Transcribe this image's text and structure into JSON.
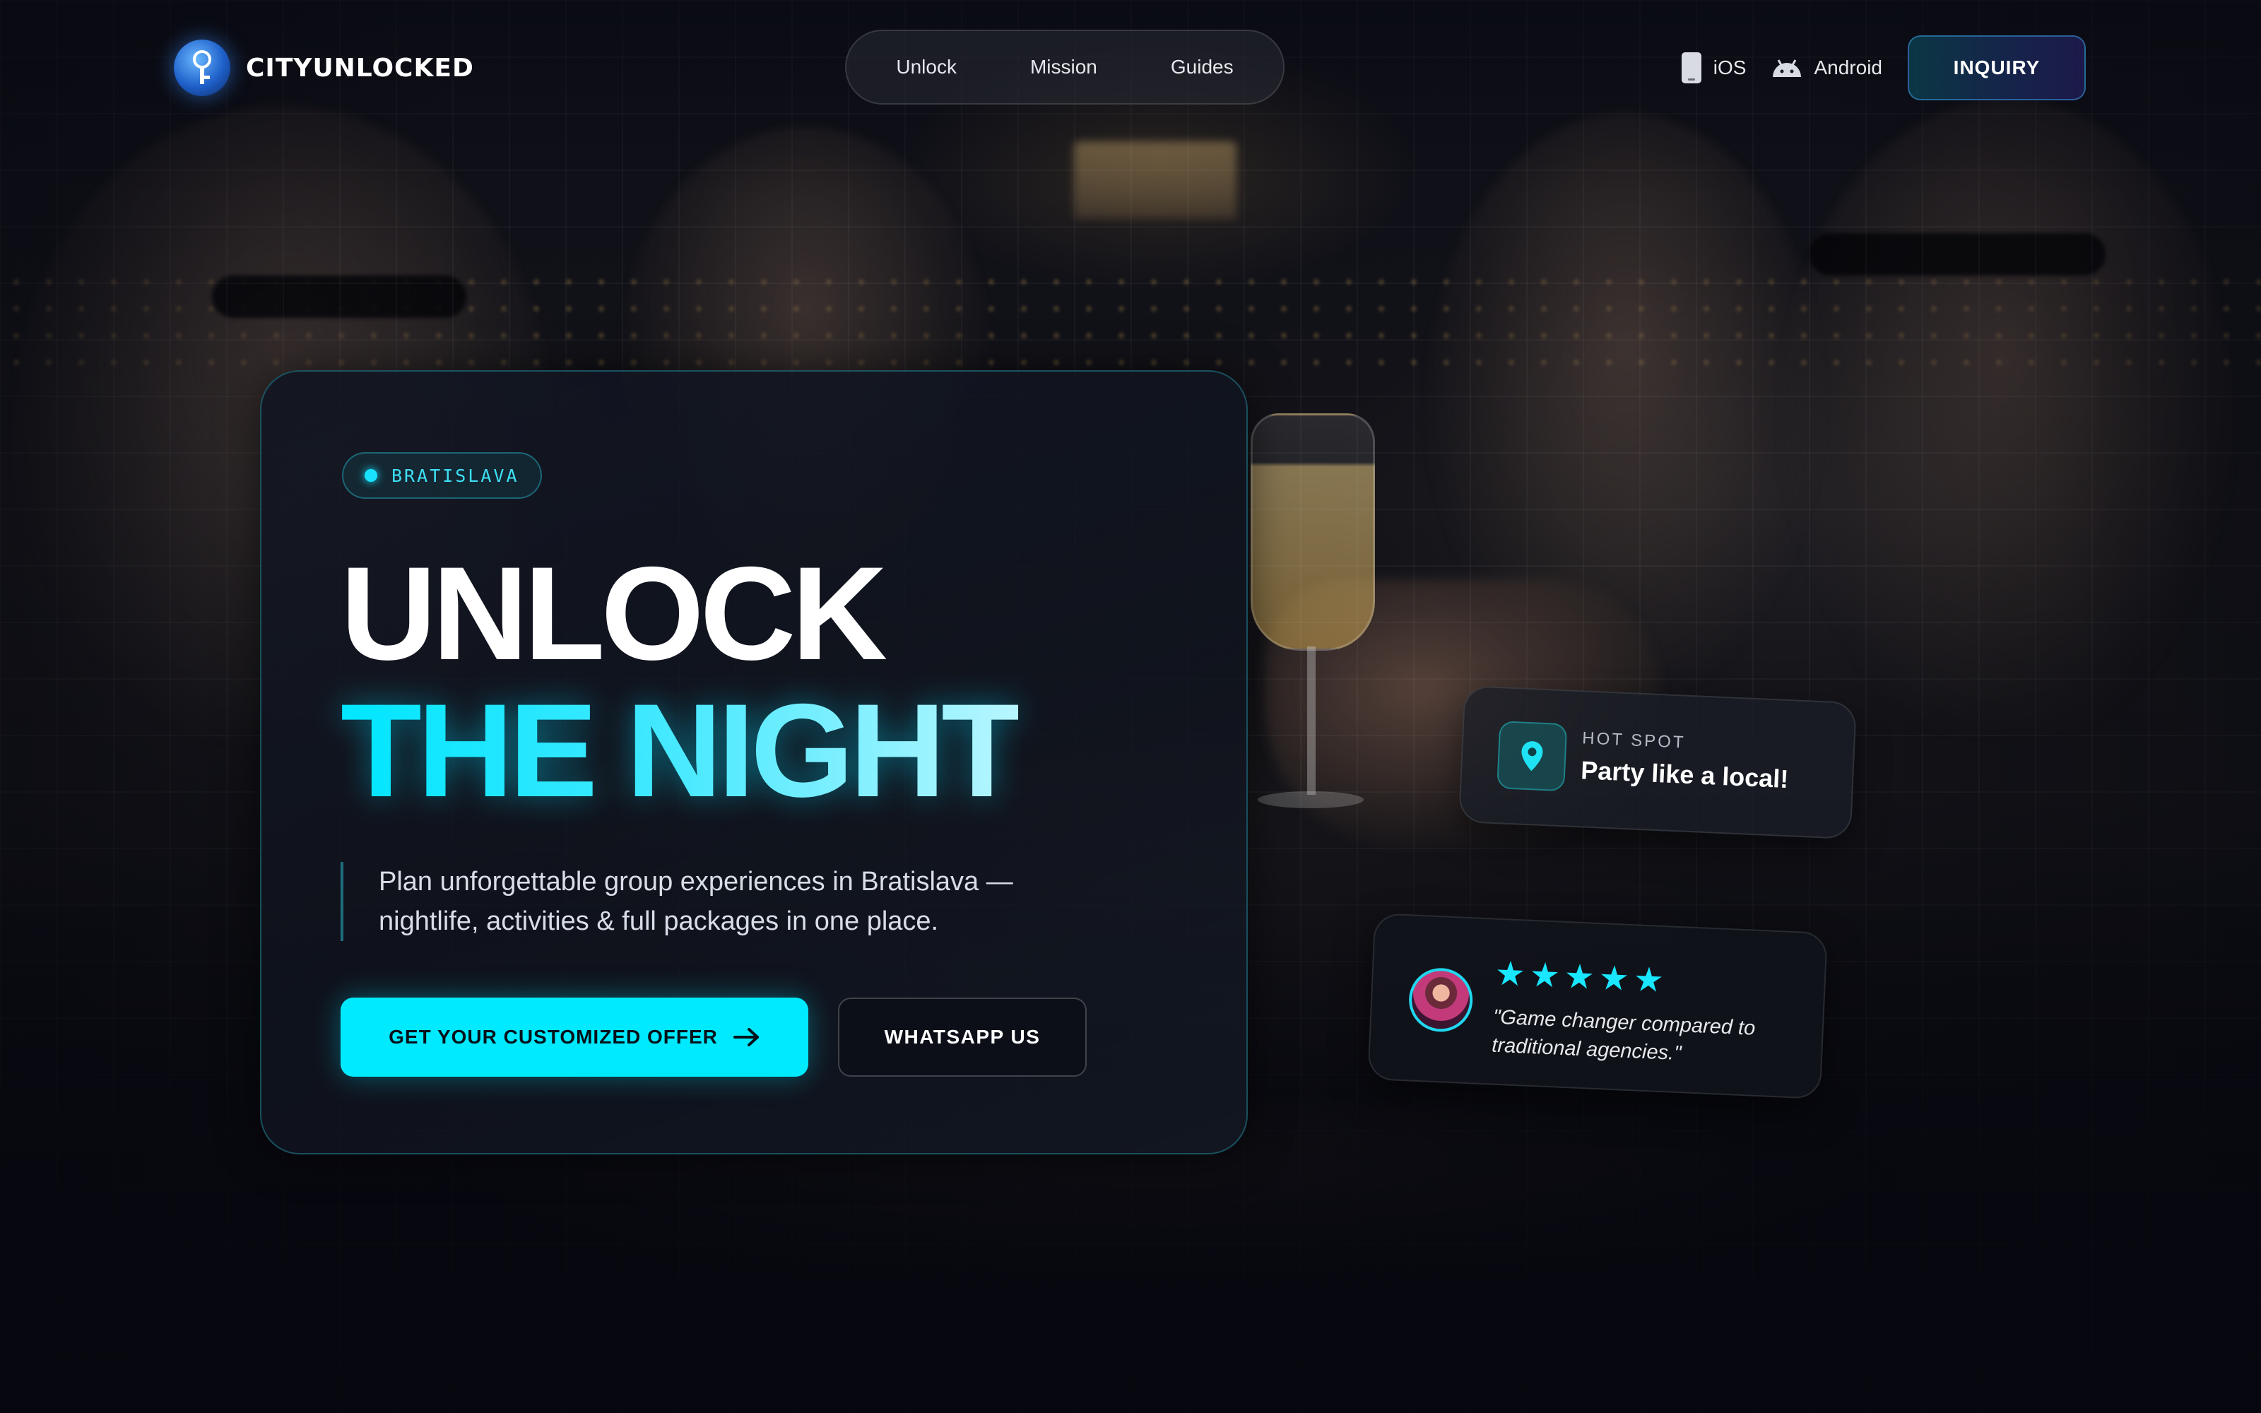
{
  "brand": {
    "name": "CITYUNLOCKED",
    "logo_icon": "key-icon"
  },
  "nav": {
    "links": [
      {
        "label": "Unlock"
      },
      {
        "label": "Mission"
      },
      {
        "label": "Guides"
      }
    ]
  },
  "header_actions": {
    "ios_label": "iOS",
    "android_label": "Android",
    "inquiry_label": "INQUIRY"
  },
  "hero": {
    "badge": "BRATISLAVA",
    "headline_line1": "UNLOCK",
    "headline_line2": "THE NIGHT",
    "subtitle": "Plan unforgettable group experiences in Bratislava — nightlife, activities & full packages in one place.",
    "cta_primary": "GET YOUR CUSTOMIZED OFFER",
    "cta_secondary": "WHATSAPP US"
  },
  "hotspot": {
    "kicker": "HOT SPOT",
    "title": "Party like a local!",
    "icon": "map-pin-icon"
  },
  "review": {
    "rating": 5,
    "max_rating": 5,
    "quote": "\"Game changer compared to traditional agencies.\""
  },
  "colors": {
    "accent": "#00eaff",
    "background": "#07080f",
    "headline_white": "#ffffff"
  }
}
